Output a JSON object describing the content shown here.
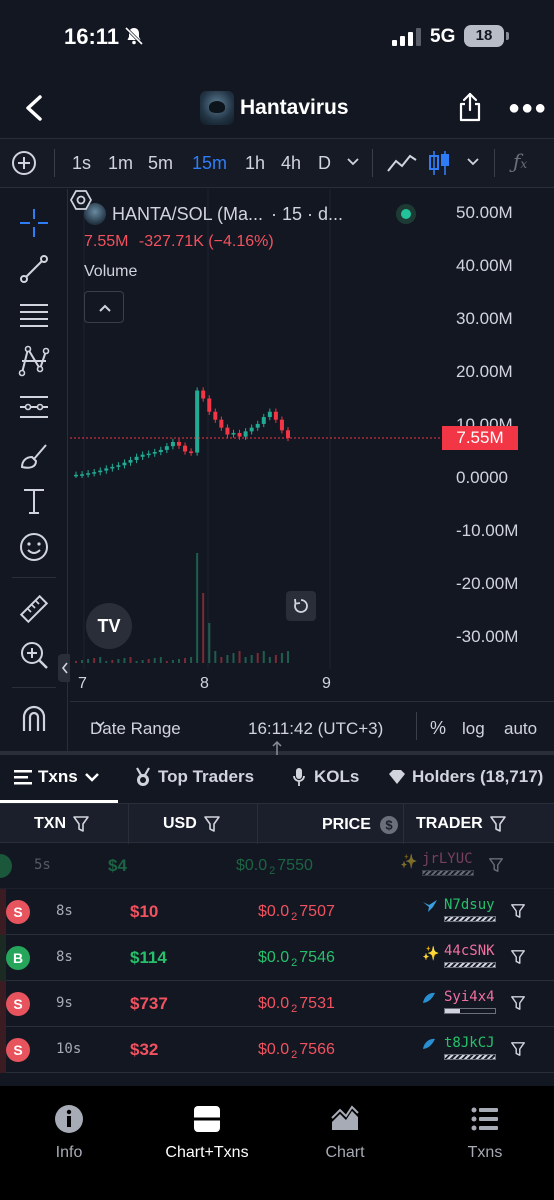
{
  "status": {
    "time": "16:11",
    "network": "5G",
    "battery": "18"
  },
  "header": {
    "title": "Hantavirus"
  },
  "toolbar": {
    "timeframes": [
      "1s",
      "1m",
      "5m",
      "15m",
      "1h",
      "4h",
      "D"
    ],
    "active_timeframe": "15m"
  },
  "chart": {
    "symbol": "HANTA/SOL (Ma...",
    "interval_info": "· 15 · d...",
    "ohlc_last": "7.55M",
    "ohlc_change": "-327.71K (−4.16%)",
    "volume_label": "Volume",
    "price_tag": "7.55M",
    "tv_logo": "TV",
    "date_range_label": "Date Range",
    "clock": "16:11:42 (UTC+3)",
    "pct_label": "%",
    "log_label": "log",
    "auto_label": "auto"
  },
  "chart_data": {
    "type": "line",
    "title": "",
    "y_ticks": [
      "50.00M",
      "40.00M",
      "30.00M",
      "20.00M",
      "10.00M",
      "0.0000",
      "-10.00M",
      "-20.00M",
      "-30.00M"
    ],
    "x_ticks": [
      "7",
      "8",
      "9"
    ],
    "last_price": "7.55M",
    "series": [
      {
        "values": [
          0.6,
          0.7,
          0.9,
          1.1,
          1.4,
          1.8,
          2.1,
          2.4,
          2.9,
          3.4,
          4.0,
          4.4,
          4.6,
          4.9,
          5.3,
          6.0,
          6.8,
          6.1,
          5.0,
          4.8,
          16.5,
          15.0,
          12.5,
          11.0,
          9.5,
          8.2,
          8.5,
          7.8,
          8.8,
          9.5,
          10.2,
          11.5,
          12.5,
          11.0,
          9.0,
          7.55
        ]
      }
    ],
    "ylim": [
      -35,
      55
    ],
    "grid": false
  },
  "txn_tabs": {
    "items": [
      "Txns",
      "Top Traders",
      "KOLs",
      "Holders (18,717)"
    ]
  },
  "table": {
    "headers": {
      "txn": "TXN",
      "usd": "USD",
      "price": "PRICE",
      "trader": "TRADER"
    },
    "rows": [
      {
        "type": "",
        "age": "5s",
        "usd": "$4",
        "price_pre": "$0.0",
        "price_zeros": "2",
        "price_post": "7550",
        "trader": "jrLYUC",
        "side": "b",
        "faded": true
      },
      {
        "type": "S",
        "age": "8s",
        "usd": "$10",
        "price_pre": "$0.0",
        "price_zeros": "2",
        "price_post": "7507",
        "trader": "N7dsuy",
        "side": "s",
        "faded": false
      },
      {
        "type": "B",
        "age": "8s",
        "usd": "$114",
        "price_pre": "$0.0",
        "price_zeros": "2",
        "price_post": "7546",
        "trader": "44cSNK",
        "side": "b",
        "faded": false
      },
      {
        "type": "S",
        "age": "9s",
        "usd": "$737",
        "price_pre": "$0.0",
        "price_zeros": "2",
        "price_post": "7531",
        "trader": "Syi4x4",
        "side": "s",
        "faded": false
      },
      {
        "type": "S",
        "age": "10s",
        "usd": "$32",
        "price_pre": "$0.0",
        "price_zeros": "2",
        "price_post": "7566",
        "trader": "t8JkCJ",
        "side": "s",
        "faded": false
      }
    ]
  },
  "bottom_nav": {
    "items": [
      "Info",
      "Chart+Txns",
      "Chart",
      "Txns"
    ],
    "active": "Chart+Txns"
  }
}
